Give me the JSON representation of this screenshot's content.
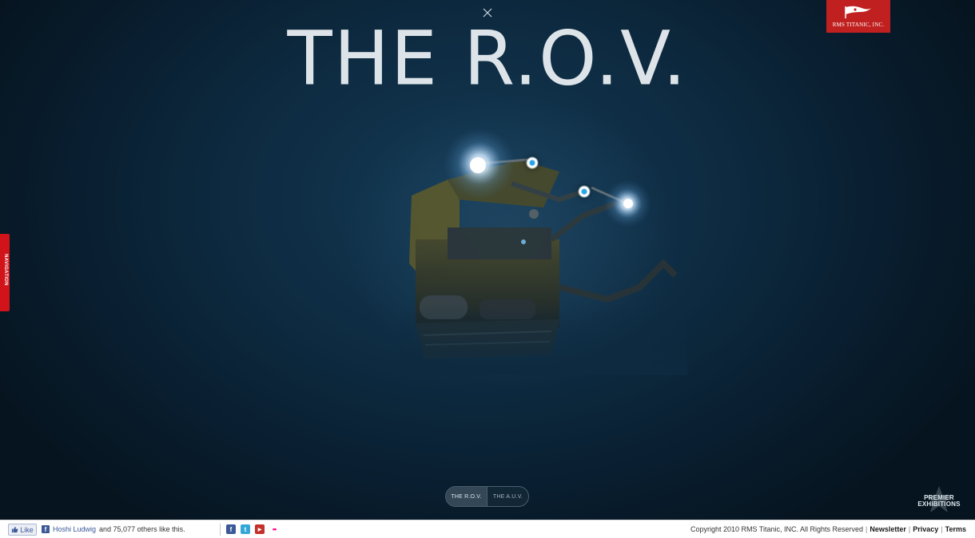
{
  "page": {
    "title": "THE R.O.V.",
    "close_icon": "close-icon"
  },
  "brand": {
    "name": "RMS TITANIC, INC.",
    "color": "#c0201f",
    "icon": "pennant-flag-icon"
  },
  "navigation_tab": {
    "label": "NAVIGATION",
    "color": "#d0141a"
  },
  "hotspots": [
    {
      "name": "hotspot-1",
      "color": "#2aa5e8"
    },
    {
      "name": "hotspot-2",
      "color": "#2aa5e8"
    }
  ],
  "switcher": {
    "options": [
      {
        "label": "THE R.O.V.",
        "active": true
      },
      {
        "label": "THE A.U.V.",
        "active": false
      }
    ]
  },
  "premier": {
    "line1": "PREMIER",
    "line2": "EXHIBITIONS",
    "icon": "star-icon"
  },
  "footer": {
    "like_label": "Like",
    "like_user": "Hoshi Ludwig",
    "like_rest": "and 75,077 others like this.",
    "social": [
      {
        "name": "facebook-icon",
        "glyph": "f",
        "color": "#3b5998"
      },
      {
        "name": "twitter-icon",
        "glyph": "t",
        "color": "#33a8d8"
      },
      {
        "name": "youtube-icon",
        "glyph": "▶",
        "color": "#c4302b"
      },
      {
        "name": "flickr-icon",
        "glyph": "••",
        "color": "#ffffff"
      }
    ],
    "copyright": "Copyright 2010 RMS Titanic, INC. All Rights Reserved",
    "links": [
      "Newsletter",
      "Privacy",
      "Terms"
    ]
  }
}
